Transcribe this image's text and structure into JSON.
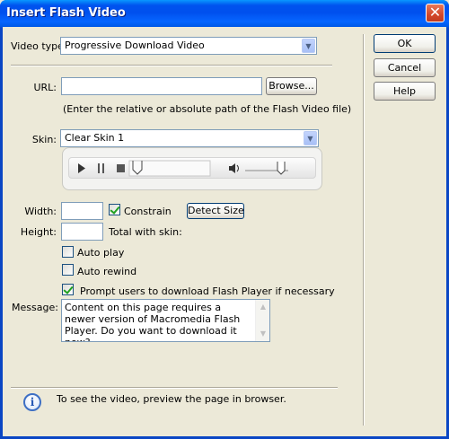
{
  "window": {
    "title": "Insert Flash Video"
  },
  "video_type": {
    "label": "Video type:",
    "value": "Progressive Download Video"
  },
  "buttons": {
    "ok": "OK",
    "cancel": "Cancel",
    "help": "Help",
    "browse": "Browse...",
    "detect_size": "Detect Size"
  },
  "url": {
    "label": "URL:",
    "value": "",
    "hint": "(Enter the relative or absolute path of the Flash Video file)"
  },
  "skin": {
    "label": "Skin:",
    "value": "Clear Skin 1"
  },
  "size": {
    "width_label": "Width:",
    "width_value": "",
    "height_label": "Height:",
    "height_value": "",
    "constrain_label": "Constrain",
    "constrain_checked": true,
    "total_label": "Total with skin:"
  },
  "options": {
    "auto_play": {
      "label": "Auto play",
      "checked": false
    },
    "auto_rewind": {
      "label": "Auto rewind",
      "checked": false
    },
    "prompt_download": {
      "label": "Prompt users to download Flash Player if necessary",
      "checked": true
    }
  },
  "message": {
    "label": "Message:",
    "text": "Content on this page requires a newer version of Macromedia Flash Player. Do you want to download it now?"
  },
  "footer": {
    "info": "To see the video, preview the page in browser."
  },
  "icons": {
    "close": "close-icon",
    "dropdown": "chevron-down-icon",
    "play": "play-icon",
    "pause": "pause-icon",
    "stop": "stop-icon",
    "volume": "speaker-icon",
    "info": "info-icon"
  }
}
